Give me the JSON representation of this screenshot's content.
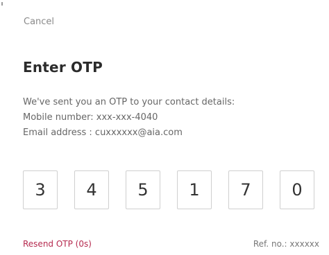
{
  "cancel_label": "Cancel",
  "title": "Enter OTP",
  "message": {
    "line1": "We've sent you an OTP to your contact details:",
    "line2": "Mobile number: xxx-xxx-4040",
    "line3": "Email address : cuxxxxxx@aia.com"
  },
  "otp_digits": [
    "3",
    "4",
    "5",
    "1",
    "7",
    "0"
  ],
  "resend_label": "Resend OTP (0s)",
  "reference": "Ref. no.: xxxxxx",
  "colors": {
    "accent": "#b5294e",
    "muted_text": "#8a8a8a",
    "body_text": "#666666",
    "heading": "#2b2b2b",
    "box_border": "#cfcfcf"
  }
}
